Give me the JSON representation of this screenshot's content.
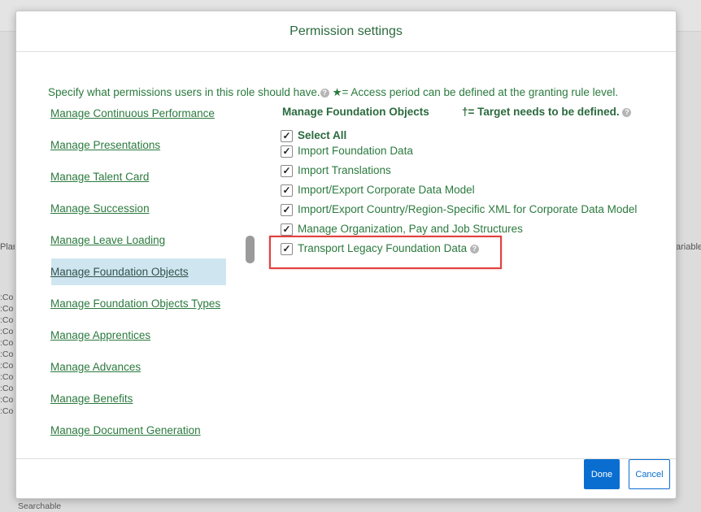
{
  "background": {
    "left_fragment": "Plan",
    "right_fragment": "ariable",
    "column_fragments": [
      ":Co",
      ":Co",
      ":Co",
      ":Co",
      ":Co",
      ":Co",
      ":Co",
      ":Co",
      ":Co",
      ":Co",
      ":Co"
    ],
    "bottom_fragments": [
      "Searchable",
      "Searchable"
    ]
  },
  "dialog": {
    "title": "Permission settings",
    "intro": "Specify what permissions users in this role should have.",
    "access_note": "★= Access period can be defined at the granting rule level.",
    "left_items": [
      "Manage Continuous Performance",
      "Manage Presentations",
      "Manage Talent Card",
      "Manage Succession",
      "Manage Leave Loading",
      "Manage Foundation Objects",
      "Manage Foundation Objects Types",
      "Manage Apprentices",
      "Manage Advances",
      "Manage Benefits",
      "Manage Document Generation"
    ],
    "selected_item": "Manage Foundation Objects",
    "right_header": "Manage Foundation Objects",
    "target_note": "†= Target needs to be defined.",
    "permissions": [
      {
        "label": "Select All",
        "checked": true
      },
      {
        "label": "Import Foundation Data",
        "checked": true
      },
      {
        "label": "Import Translations",
        "checked": true
      },
      {
        "label": "Import/Export Corporate Data Model",
        "checked": true
      },
      {
        "label": "Import/Export Country/Region-Specific XML for Corporate Data Model",
        "checked": true
      },
      {
        "label": "Manage Organization, Pay and Job Structures",
        "checked": true
      },
      {
        "label": "Transport Legacy Foundation Data",
        "checked": true
      }
    ],
    "checkmark_glyph": "✓",
    "help_glyph": "?",
    "done_label": "Done",
    "cancel_label": "Cancel"
  },
  "colors": {
    "accent": "#0a6ed1",
    "link_green": "#2b7a3e",
    "selected_bg": "#cfe6f1",
    "highlight": "#e0413f"
  }
}
